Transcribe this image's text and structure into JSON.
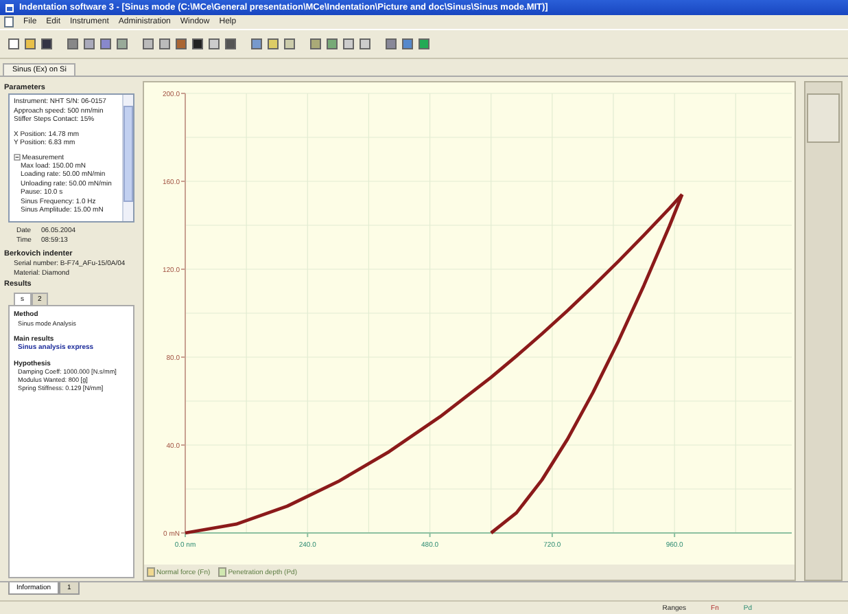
{
  "window": {
    "title": "Indentation software 3 - [Sinus mode  (C:\\MCe\\General presentation\\MCe\\Indentation\\Picture and doc\\Sinus\\Sinus mode.MIT)]"
  },
  "menu": [
    "File",
    "Edit",
    "Instrument",
    "Administration",
    "Window",
    "Help"
  ],
  "document_tabs": [
    {
      "label": "Sinus (Ex) on Si",
      "selected": true
    }
  ],
  "parameters": {
    "heading": "Parameters",
    "groups": [
      {
        "lines": [
          "Instrument: NHT S/N: 06-0157",
          "Approach speed: 500 nm/min",
          "Stiffer Steps Contact: 15%"
        ]
      },
      {
        "lines": [
          "X Position: 14.78 mm",
          "Y Position: 6.83 mm"
        ]
      },
      {
        "title": "Measurement",
        "lines": [
          "Max load: 150.00 mN",
          "Loading rate: 50.00 mN/min",
          "Unloading rate: 50.00 mN/min",
          "Pause: 10.0 s",
          "Sinus Frequency: 1.0 Hz",
          "Sinus Amplitude: 15.00 mN"
        ]
      }
    ]
  },
  "info": [
    {
      "label": "Date",
      "value": "06.05.2004"
    },
    {
      "label": "Time",
      "value": "08:59:13"
    }
  ],
  "indenter": {
    "heading": "Berkovich indenter",
    "lines": [
      "Serial number: B-F74_AFu-15/0A/04",
      "Material: Diamond"
    ]
  },
  "results": {
    "heading": "Results",
    "tabs": [
      {
        "label": "s",
        "selected": true
      },
      {
        "label": "2",
        "selected": false
      }
    ],
    "sections": [
      {
        "heading": "Method",
        "lines": [
          {
            "text": "Sinus mode Analysis",
            "kind": "text"
          }
        ]
      },
      {
        "heading": "Main results",
        "lines": [
          {
            "text": "Sinus analysis express",
            "kind": "link"
          }
        ]
      },
      {
        "heading": "Hypothesis",
        "lines": [
          {
            "text": "Damping Coeff: 1000.000 [N.s/mm]",
            "kind": "text"
          },
          {
            "text": "Modulus Wanted: 800 [g]",
            "kind": "text"
          },
          {
            "text": "Spring Stiffness: 0.129 [N/mm]",
            "kind": "text"
          }
        ]
      }
    ]
  },
  "chart": {
    "chart_data": {
      "type": "line",
      "x": [
        0,
        100,
        200,
        300,
        400,
        500,
        600,
        650,
        700,
        750,
        800,
        850,
        900,
        950,
        975
      ],
      "series": [
        {
          "color": "#8b1a1a",
          "values": [
            0,
            4.0,
            12.2,
            23.4,
            37.0,
            52.9,
            70.8,
            80.5,
            90.6,
            101.2,
            112.2,
            123.6,
            135.5,
            147.7,
            154
          ]
        },
        {
          "color": "#8b1a1a",
          "values": [
            null,
            null,
            null,
            null,
            null,
            null,
            0,
            9.2,
            24.2,
            42.7,
            63.9,
            87.3,
            112.7,
            139.7,
            154
          ]
        }
      ],
      "grid": true,
      "xlim": [
        0,
        1190
      ],
      "ylim": [
        0,
        200
      ],
      "xticks": [
        {
          "value": 0,
          "label": "0.0 nm"
        },
        {
          "value": 240,
          "label": "240.0"
        },
        {
          "value": 480,
          "label": "480.0"
        },
        {
          "value": 720,
          "label": "720.0"
        },
        {
          "value": 960,
          "label": "960.0"
        }
      ],
      "yticks": [
        {
          "value": 0,
          "label": "0 mN"
        },
        {
          "value": 40,
          "label": "40.0"
        },
        {
          "value": 80,
          "label": "80.0"
        },
        {
          "value": 120,
          "label": "120.0"
        },
        {
          "value": 160,
          "label": "160.0"
        },
        {
          "value": 200,
          "label": "200.0"
        }
      ]
    },
    "legend": [
      "Normal force (Fn)",
      "Penetration depth (Pd)"
    ]
  },
  "bottom_tabs": [
    {
      "label": "Information",
      "selected": true
    },
    {
      "label": "1",
      "selected": false
    }
  ],
  "status_bar": [
    "Ranges",
    "Fn",
    "Pd"
  ]
}
